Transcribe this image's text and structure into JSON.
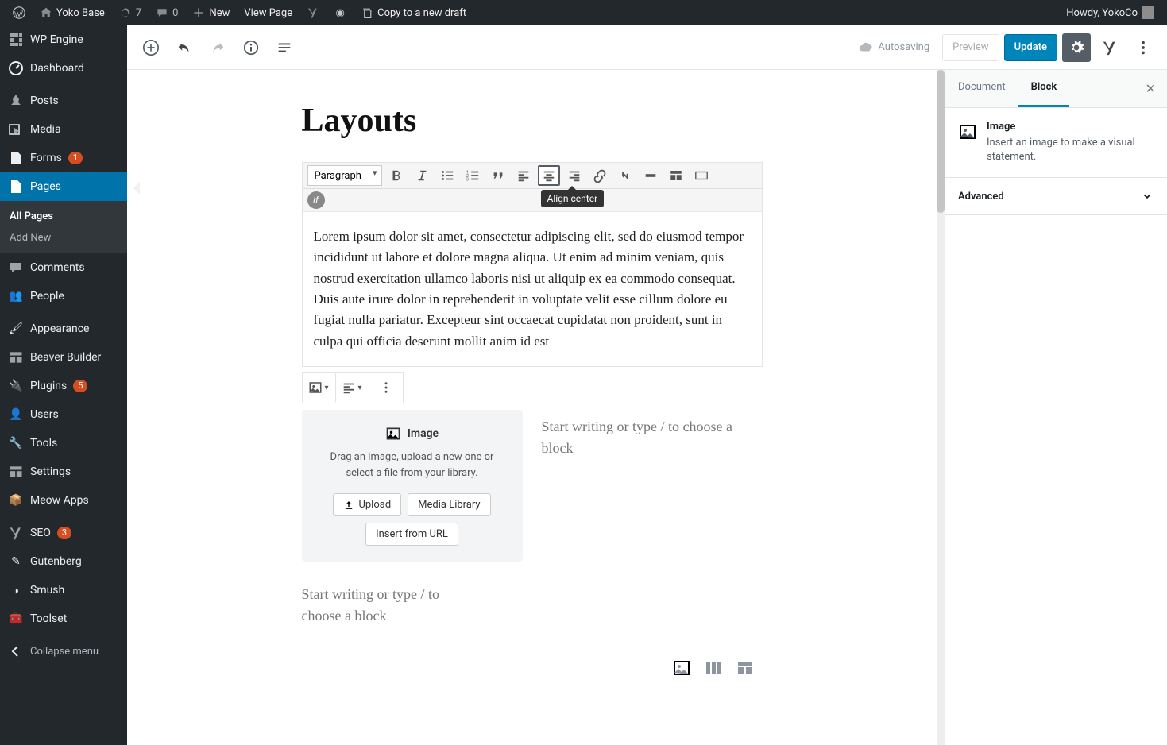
{
  "adminbar": {
    "site": "Yoko Base",
    "updates": "7",
    "comments": "0",
    "new": "New",
    "view": "View Page",
    "copy": "Copy to a new draft",
    "howdy": "Howdy, YokoCo"
  },
  "sidebar": {
    "items": [
      {
        "label": "WP Engine"
      },
      {
        "label": "Dashboard"
      },
      {
        "label": "Posts"
      },
      {
        "label": "Media"
      },
      {
        "label": "Forms",
        "badge": "1"
      },
      {
        "label": "Pages"
      },
      {
        "label": "Comments"
      },
      {
        "label": "People"
      },
      {
        "label": "Appearance"
      },
      {
        "label": "Beaver Builder"
      },
      {
        "label": "Plugins",
        "badge": "5"
      },
      {
        "label": "Users"
      },
      {
        "label": "Tools"
      },
      {
        "label": "Settings"
      },
      {
        "label": "Meow Apps"
      },
      {
        "label": "SEO",
        "badge": "3"
      },
      {
        "label": "Gutenberg"
      },
      {
        "label": "Smush"
      },
      {
        "label": "Toolset"
      }
    ],
    "sub": {
      "all": "All Pages",
      "add": "Add New"
    },
    "collapse": "Collapse menu"
  },
  "topbar": {
    "autosaving": "Autosaving",
    "preview": "Preview",
    "update": "Update"
  },
  "editor": {
    "title": "Layouts",
    "format": "Paragraph",
    "tooltip": "Align center",
    "paragraph": "Lorem ipsum dolor sit amet, consectetur adipiscing elit, sed do eiusmod tempor incididunt ut labore et dolore magna aliqua. Ut enim ad minim veniam, quis nostrud exercitation ullamco laboris nisi ut aliquip ex ea commodo consequat. Duis aute irure dolor in reprehenderit in voluptate velit esse cillum dolore eu fugiat nulla pariatur. Excepteur sint occaecat cupidatat non proident, sunt in culpa qui officia deserunt mollit anim id est",
    "image": {
      "title": "Image",
      "desc": "Drag an image, upload a new one or select a file from your library.",
      "upload": "Upload",
      "media": "Media Library",
      "url": "Insert from URL"
    },
    "placeholder": "Start writing or type / to choose a block"
  },
  "inspector": {
    "tabs": {
      "document": "Document",
      "block": "Block"
    },
    "block": {
      "title": "Image",
      "desc": "Insert an image to make a visual statement."
    },
    "advanced": "Advanced"
  }
}
